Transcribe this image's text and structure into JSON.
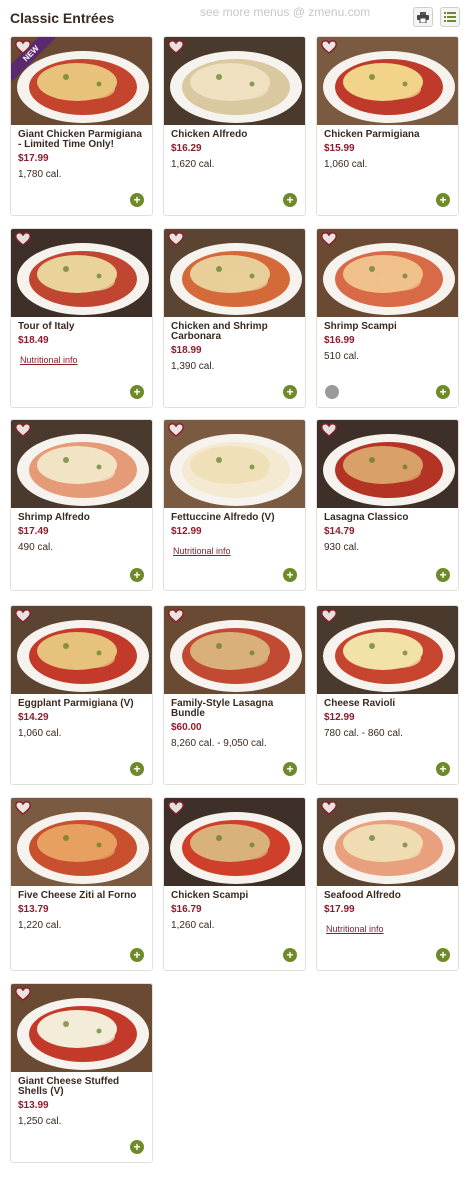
{
  "header": {
    "title": "Classic Entrées",
    "watermark": "see more menus @ zmenu.com",
    "print_icon": "printer-icon",
    "list_icon": "list-view-icon"
  },
  "colors": {
    "price": "#8c1d2b",
    "add_button": "#6e8a2a",
    "new_ribbon": "#5b2a6e"
  },
  "items": [
    {
      "name": "Giant Chicken Parmigiana - Limited Time Only!",
      "price": "$17.99",
      "calories": "1,780 cal.",
      "badge": "NEW"
    },
    {
      "name": "Chicken Alfredo",
      "price": "$16.29",
      "calories": "1,620 cal."
    },
    {
      "name": "Chicken Parmigiana",
      "price": "$15.99",
      "calories": "1,060 cal."
    },
    {
      "name": "Tour of Italy",
      "price": "$18.49",
      "nutrition_link": "Nutritional info"
    },
    {
      "name": "Chicken and Shrimp Carbonara",
      "price": "$18.99",
      "calories": "1,390 cal."
    },
    {
      "name": "Shrimp Scampi",
      "price": "$16.99",
      "calories": "510 cal.",
      "icon": "spicy-icon"
    },
    {
      "name": "Shrimp Alfredo",
      "price": "$17.49",
      "calories": "490 cal."
    },
    {
      "name": "Fettuccine Alfredo (V)",
      "price": "$12.99",
      "nutrition_link": "Nutritional info"
    },
    {
      "name": "Lasagna Classico",
      "price": "$14.79",
      "calories": "930 cal."
    },
    {
      "name": "Eggplant Parmigiana (V)",
      "price": "$14.29",
      "calories": "1,060 cal."
    },
    {
      "name": "Family-Style Lasagna Bundle",
      "price": "$60.00",
      "calories": "8,260 cal. - 9,050 cal."
    },
    {
      "name": "Cheese Ravioli",
      "price": "$12.99",
      "calories": "780 cal. - 860 cal."
    },
    {
      "name": "Five Cheese Ziti al Forno",
      "price": "$13.79",
      "calories": "1,220 cal."
    },
    {
      "name": "Chicken Scampi",
      "price": "$16.79",
      "calories": "1,260 cal."
    },
    {
      "name": "Seafood Alfredo",
      "price": "$17.99",
      "nutrition_link": "Nutritional info"
    },
    {
      "name": "Giant Cheese Stuffed Shells (V)",
      "price": "$13.99",
      "calories": "1,250 cal."
    }
  ]
}
